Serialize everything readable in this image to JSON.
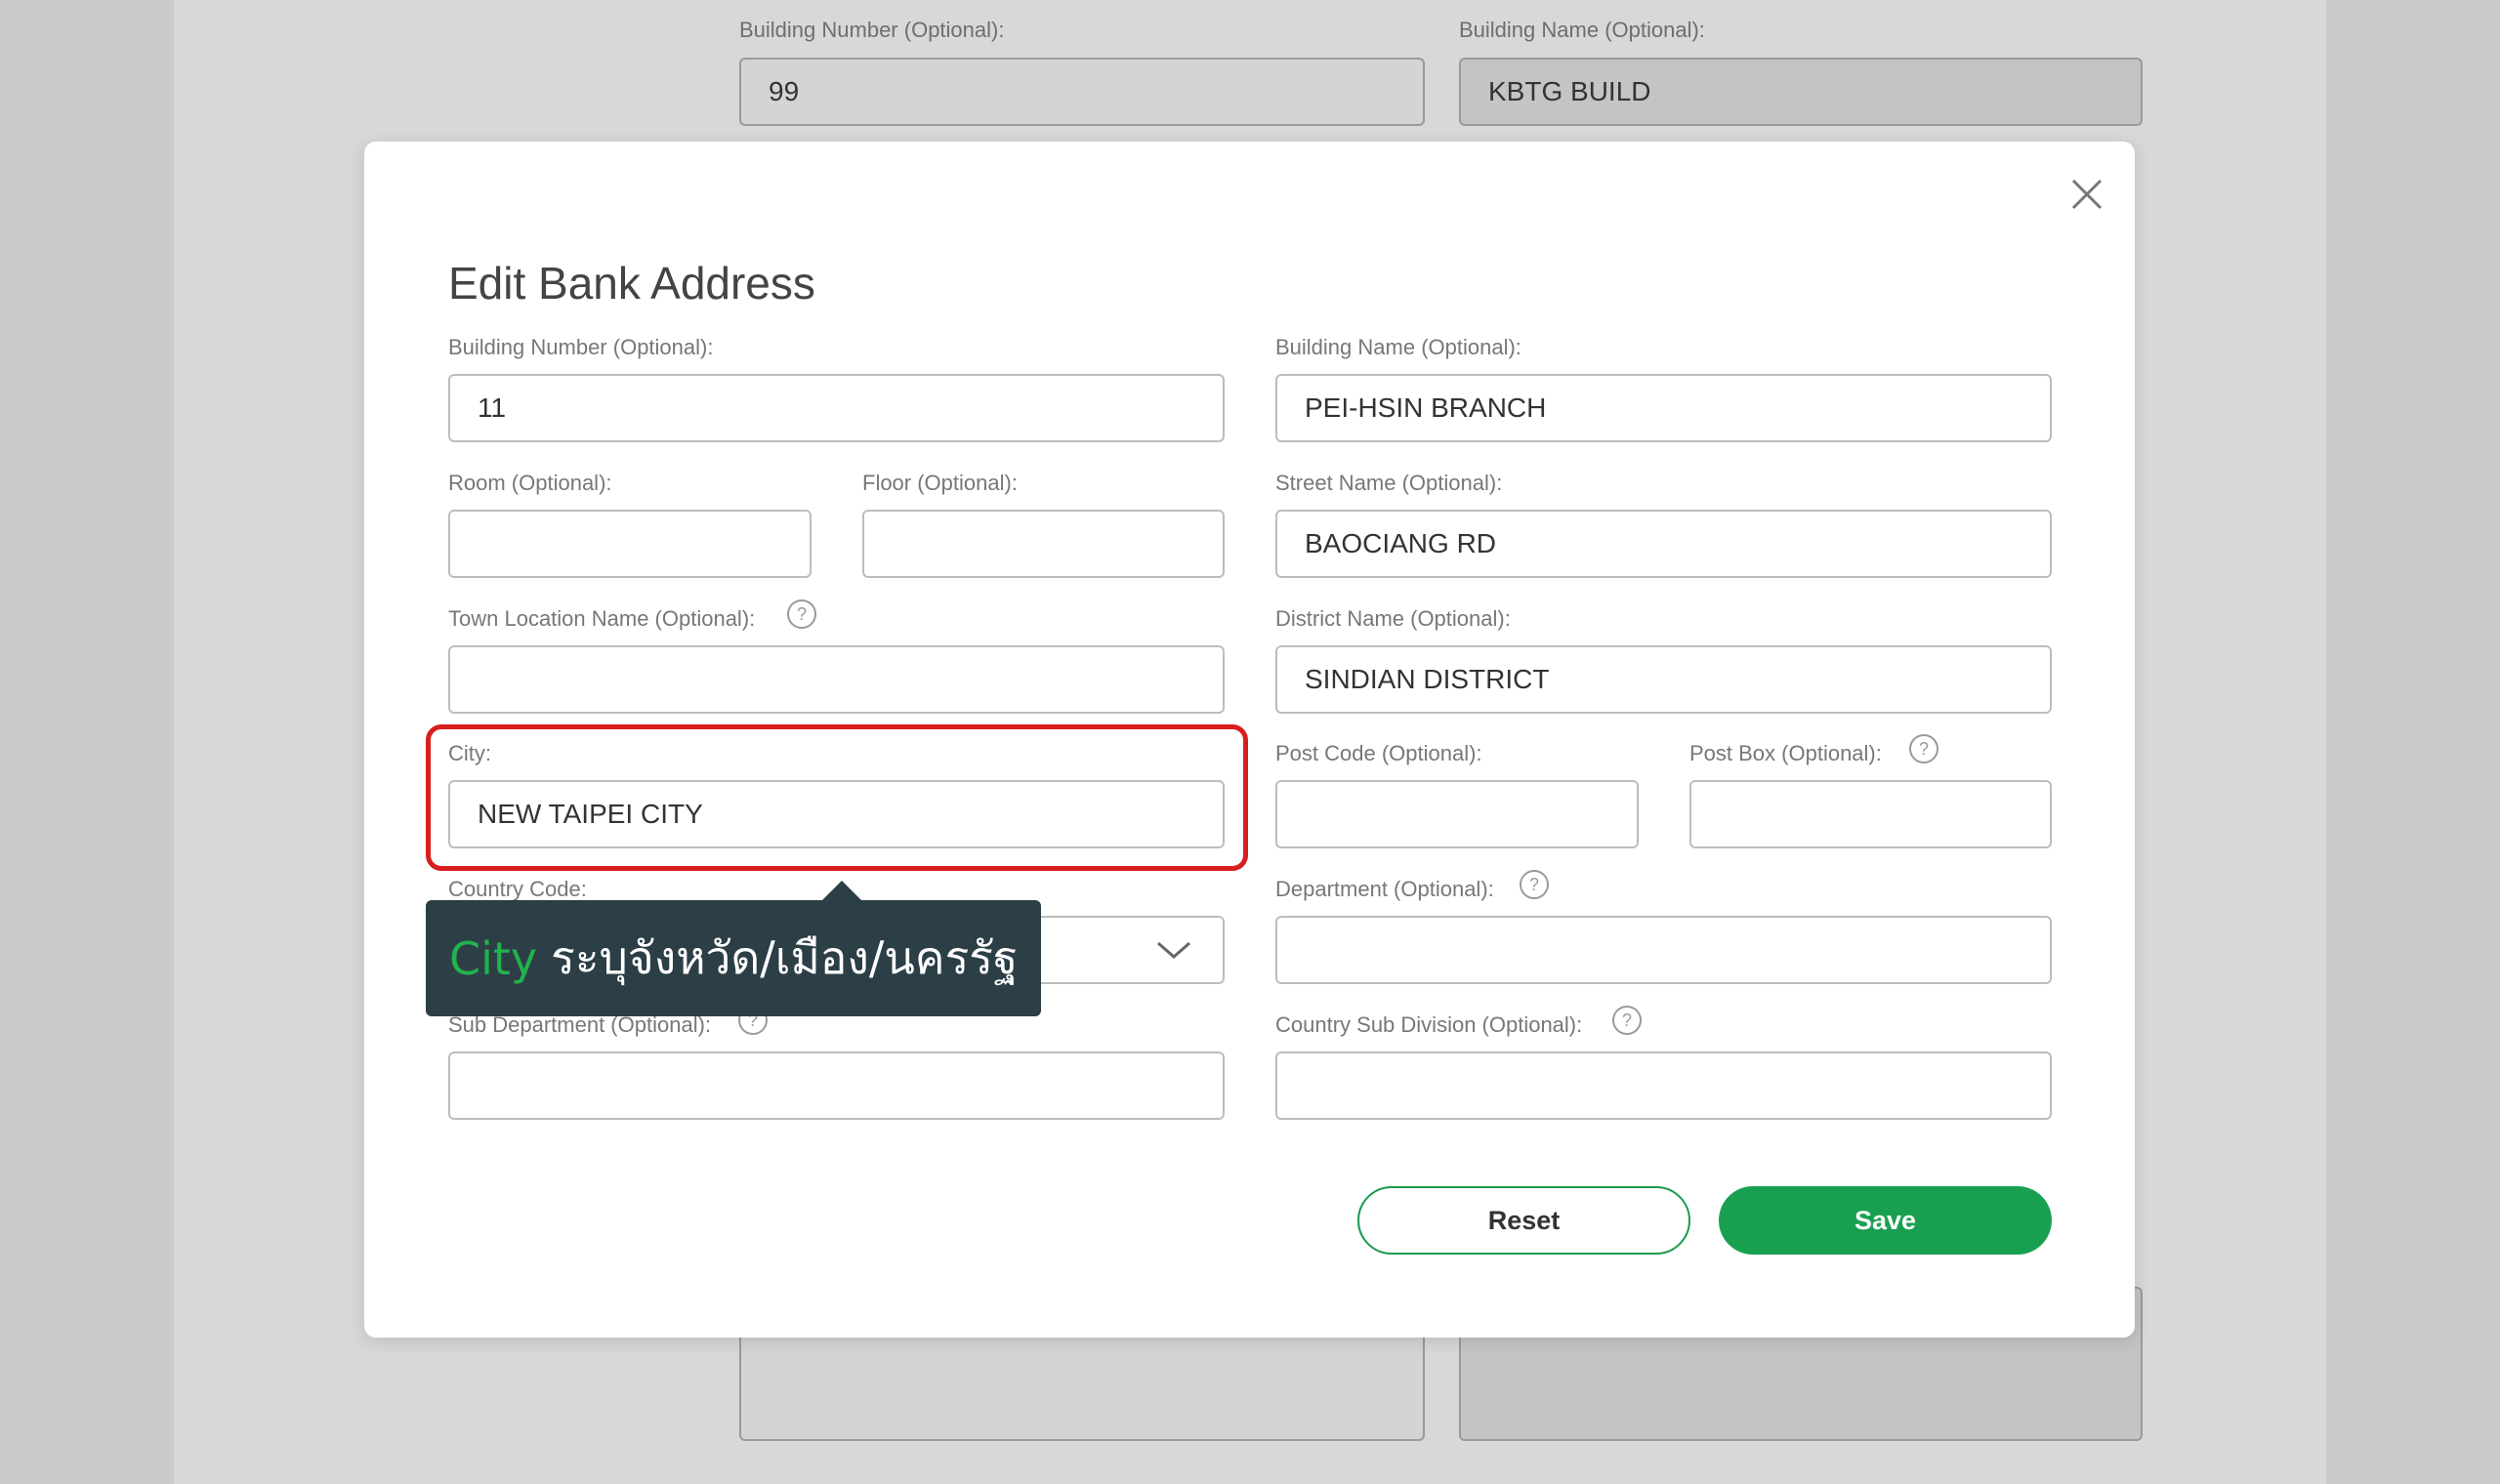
{
  "background": {
    "building_number_label": "Building Number (Optional):",
    "building_number_value": "99",
    "building_name_label": "Building Name (Optional):",
    "building_name_value": "KBTG BUILD"
  },
  "modal": {
    "title": "Edit Bank Address",
    "fields": {
      "building_number": {
        "label": "Building Number (Optional):",
        "value": "11"
      },
      "building_name": {
        "label": "Building Name (Optional):",
        "value": "PEI-HSIN BRANCH"
      },
      "room": {
        "label": "Room (Optional):",
        "value": ""
      },
      "floor": {
        "label": "Floor (Optional):",
        "value": ""
      },
      "street_name": {
        "label": "Street Name (Optional):",
        "value": "BAOCIANG RD"
      },
      "town_location": {
        "label": "Town Location Name (Optional):",
        "value": ""
      },
      "district_name": {
        "label": "District Name (Optional):",
        "value": "SINDIAN DISTRICT"
      },
      "city": {
        "label": "City:",
        "value": "NEW TAIPEI CITY"
      },
      "post_code": {
        "label": "Post Code (Optional):",
        "value": ""
      },
      "post_box": {
        "label": "Post Box (Optional):",
        "value": ""
      },
      "country_code": {
        "label": "Country Code:",
        "value": ""
      },
      "department": {
        "label": "Department (Optional):",
        "value": ""
      },
      "sub_department": {
        "label": "Sub Department (Optional):",
        "value": ""
      },
      "country_sub_division": {
        "label": "Country Sub Division (Optional):",
        "value": ""
      }
    },
    "help_symbol": "?",
    "buttons": {
      "reset": "Reset",
      "save": "Save"
    }
  },
  "tooltip": {
    "keyword": "City",
    "text": "ระบุจังหวัด/เมือง/นครรัฐ"
  },
  "colors": {
    "accent_green": "#18a050",
    "highlight_red": "#d91e1e",
    "tooltip_bg": "#2c3e46"
  }
}
